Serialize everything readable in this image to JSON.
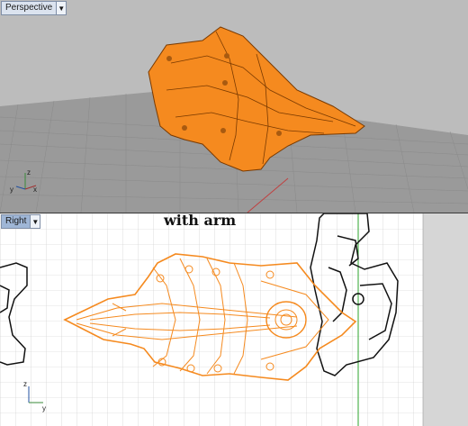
{
  "viewports": {
    "perspective": {
      "label": "Perspective",
      "axis_x": "x",
      "axis_y": "y",
      "axis_z": "z"
    },
    "right": {
      "label": "Right",
      "axis_y": "y",
      "axis_z": "z"
    }
  },
  "overlay": {
    "title": "with arm"
  },
  "icons": {
    "dropdown": "chevron-down-icon"
  },
  "colors": {
    "selection": "#f58a1f",
    "grid_bg_top": "#bcbcbc",
    "grid_bg_bottom": "#ffffff",
    "accent_line": "#2da52d"
  }
}
